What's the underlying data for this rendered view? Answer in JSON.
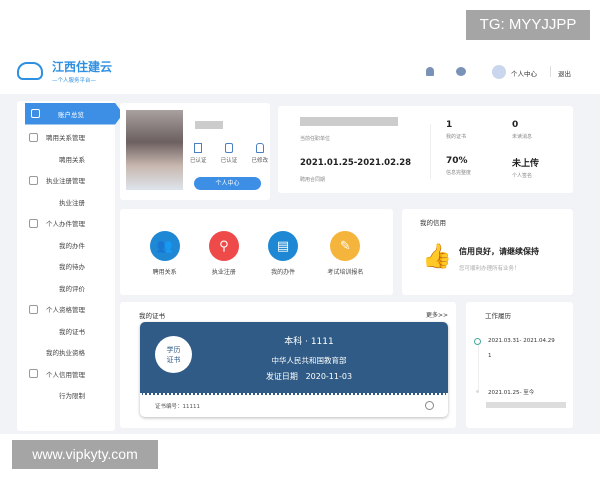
{
  "watermark_top": "TG: MYYJJPP",
  "watermark_bottom": "www.vipkyty.com",
  "header": {
    "logo_title": "江西住建云",
    "logo_subtitle": "—个人服务平台—",
    "user_center": "个人中心",
    "logout": "退出"
  },
  "sidebar": {
    "items": [
      {
        "label": "账户总览",
        "type": "active"
      },
      {
        "label": "聘用关系管理",
        "type": "group"
      },
      {
        "label": "聘用关系",
        "type": "sub"
      },
      {
        "label": "执业注册管理",
        "type": "group"
      },
      {
        "label": "执业注册",
        "type": "sub"
      },
      {
        "label": "个人办件管理",
        "type": "group"
      },
      {
        "label": "我的办件",
        "type": "sub"
      },
      {
        "label": "我的待办",
        "type": "sub"
      },
      {
        "label": "我的评价",
        "type": "sub"
      },
      {
        "label": "个人资格管理",
        "type": "group"
      },
      {
        "label": "我的证书",
        "type": "sub"
      },
      {
        "label": "我的执业资格",
        "type": "sub"
      },
      {
        "label": "个人信用管理",
        "type": "group"
      },
      {
        "label": "行为限制",
        "type": "sub"
      }
    ]
  },
  "profile": {
    "badges": [
      "已认证",
      "已认证",
      "已修改"
    ],
    "button": "个人中心"
  },
  "stats": {
    "employer_label": "当前任职单位",
    "contract_period": "2021.01.25-2021.02.28",
    "contract_label": "聘用合同期",
    "items": [
      {
        "value": "1",
        "label": "我的证书"
      },
      {
        "value": "0",
        "label": "未读消息"
      },
      {
        "value": "70%",
        "label": "信息完整度"
      },
      {
        "value": "未上传",
        "label": "个人签名"
      }
    ]
  },
  "quick_links": [
    {
      "label": "聘用关系",
      "color": "#1e88d4"
    },
    {
      "label": "执业注册",
      "color": "#ef4a4a"
    },
    {
      "label": "我的办件",
      "color": "#1e88d4"
    },
    {
      "label": "考试培训报名",
      "color": "#f5b43c"
    }
  ],
  "credit": {
    "title": "我的信用",
    "status": "信用良好，请继续保持",
    "subtitle": "您可顺利办理所有业务！"
  },
  "certificate": {
    "title": "我的证书",
    "more": "更多>>",
    "badge_line1": "学历",
    "badge_line2": "证书",
    "degree": "本科 · 1111",
    "issuer": "中华人民共和国教育部",
    "issue_date_label": "发证日期",
    "issue_date": "2020-11-03",
    "number": "证书编号：11111",
    "card_color": "#2f5b86"
  },
  "work_history": {
    "title": "工作履历",
    "entries": [
      {
        "period": "2021.03.31- 2021.04.29",
        "detail": "1"
      },
      {
        "period": "2021.01.25- 至今",
        "detail": ""
      }
    ]
  }
}
